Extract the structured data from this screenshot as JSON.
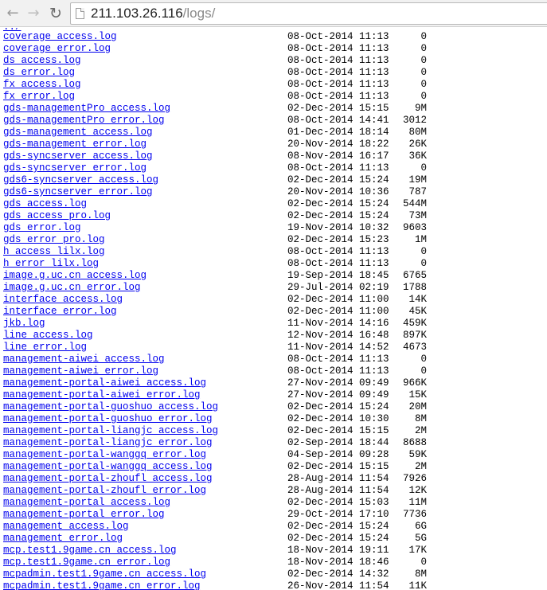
{
  "browser": {
    "url_host": "211.103.26.116",
    "url_path": "/logs/",
    "back_icon": "arrow-left-icon",
    "forward_icon": "arrow-right-icon",
    "reload_icon": "reload-icon",
    "page_icon": "page-icon"
  },
  "listing": {
    "partial_top_entry": "../",
    "entries": [
      {
        "name": "coverage_access.log",
        "date": "08-Oct-2014 11:13",
        "size": "0"
      },
      {
        "name": "coverage_error.log",
        "date": "08-Oct-2014 11:13",
        "size": "0"
      },
      {
        "name": "ds_access.log",
        "date": "08-Oct-2014 11:13",
        "size": "0"
      },
      {
        "name": "ds_error.log",
        "date": "08-Oct-2014 11:13",
        "size": "0"
      },
      {
        "name": "fx_access.log",
        "date": "08-Oct-2014 11:13",
        "size": "0"
      },
      {
        "name": "fx_error.log",
        "date": "08-Oct-2014 11:13",
        "size": "0"
      },
      {
        "name": "gds-managementPro_access.log",
        "date": "02-Dec-2014 15:15",
        "size": "9M"
      },
      {
        "name": "gds-managementPro_error.log",
        "date": "08-Oct-2014 14:41",
        "size": "3012"
      },
      {
        "name": "gds-management_access.log",
        "date": "01-Dec-2014 18:14",
        "size": "80M"
      },
      {
        "name": "gds-management_error.log",
        "date": "20-Nov-2014 18:22",
        "size": "26K"
      },
      {
        "name": "gds-syncserver_access.log",
        "date": "08-Nov-2014 16:17",
        "size": "36K"
      },
      {
        "name": "gds-syncserver_error.log",
        "date": "08-Oct-2014 11:13",
        "size": "0"
      },
      {
        "name": "gds6-syncserver_access.log",
        "date": "02-Dec-2014 15:24",
        "size": "19M"
      },
      {
        "name": "gds6-syncserver_error.log",
        "date": "20-Nov-2014 10:36",
        "size": "787"
      },
      {
        "name": "gds_access.log",
        "date": "02-Dec-2014 15:24",
        "size": "544M"
      },
      {
        "name": "gds_access_pro.log",
        "date": "02-Dec-2014 15:24",
        "size": "73M"
      },
      {
        "name": "gds_error.log",
        "date": "19-Nov-2014 10:32",
        "size": "9603"
      },
      {
        "name": "gds_error_pro.log",
        "date": "02-Dec-2014 15:23",
        "size": "1M"
      },
      {
        "name": "h_access_lilx.log",
        "date": "08-Oct-2014 11:13",
        "size": "0"
      },
      {
        "name": "h_error_lilx.log",
        "date": "08-Oct-2014 11:13",
        "size": "0"
      },
      {
        "name": "image.g.uc.cn_access.log",
        "date": "19-Sep-2014 18:45",
        "size": "6765"
      },
      {
        "name": "image.g.uc.cn_error.log",
        "date": "29-Jul-2014 02:19",
        "size": "1788"
      },
      {
        "name": "interface_access.log",
        "date": "02-Dec-2014 11:00",
        "size": "14K"
      },
      {
        "name": "interface_error.log",
        "date": "02-Dec-2014 11:00",
        "size": "45K"
      },
      {
        "name": "jkb.log",
        "date": "11-Nov-2014 14:16",
        "size": "459K"
      },
      {
        "name": "line_access.log",
        "date": "12-Nov-2014 16:48",
        "size": "897K"
      },
      {
        "name": "line_error.log",
        "date": "11-Nov-2014 14:52",
        "size": "4673"
      },
      {
        "name": "management-aiwei_access.log",
        "date": "08-Oct-2014 11:13",
        "size": "0"
      },
      {
        "name": "management-aiwei_error.log",
        "date": "08-Oct-2014 11:13",
        "size": "0"
      },
      {
        "name": "management-portal-aiwei_access.log",
        "date": "27-Nov-2014 09:49",
        "size": "966K"
      },
      {
        "name": "management-portal-aiwei_error.log",
        "date": "27-Nov-2014 09:49",
        "size": "15K"
      },
      {
        "name": "management-portal-guoshuo_access.log",
        "date": "02-Dec-2014 15:24",
        "size": "20M"
      },
      {
        "name": "management-portal-guoshuo_error.log",
        "date": "02-Dec-2014 10:30",
        "size": "8M"
      },
      {
        "name": "management-portal-liangjc_access.log",
        "date": "02-Dec-2014 15:15",
        "size": "2M"
      },
      {
        "name": "management-portal-liangjc_error.log",
        "date": "02-Sep-2014 18:44",
        "size": "8688"
      },
      {
        "name": "management-portal-wanggq_error.log",
        "date": "04-Sep-2014 09:28",
        "size": "59K"
      },
      {
        "name": "management-portal-wanggq_access.log",
        "date": "02-Dec-2014 15:15",
        "size": "2M"
      },
      {
        "name": "management-portal-zhoufl_access.log",
        "date": "28-Aug-2014 11:54",
        "size": "7926"
      },
      {
        "name": "management-portal-zhoufl_error.log",
        "date": "28-Aug-2014 11:54",
        "size": "12K"
      },
      {
        "name": "management-portal_access.log",
        "date": "02-Dec-2014 15:03",
        "size": "11M"
      },
      {
        "name": "management-portal_error.log",
        "date": "29-Oct-2014 17:10",
        "size": "7736"
      },
      {
        "name": "management_access.log",
        "date": "02-Dec-2014 15:24",
        "size": "6G"
      },
      {
        "name": "management_error.log",
        "date": "02-Dec-2014 15:24",
        "size": "5G"
      },
      {
        "name": "mcp.test1.9game.cn_access.log",
        "date": "18-Nov-2014 19:11",
        "size": "17K"
      },
      {
        "name": "mcp.test1.9game.cn_error.log",
        "date": "18-Nov-2014 18:46",
        "size": "0"
      },
      {
        "name": "mcpadmin.test1.9game.cn_access.log",
        "date": "02-Dec-2014 14:32",
        "size": "8M"
      },
      {
        "name": "mcpadmin.test1.9game.cn_error.log",
        "date": "26-Nov-2014 11:54",
        "size": "11K"
      }
    ]
  }
}
